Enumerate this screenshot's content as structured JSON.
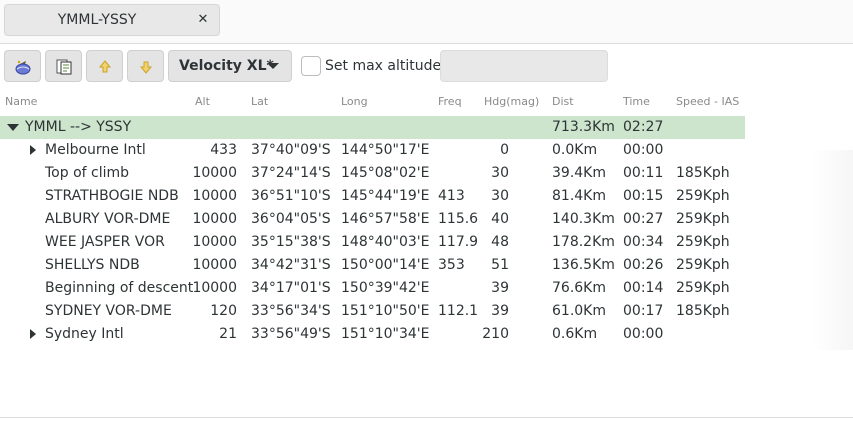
{
  "tab": {
    "title": "YMML-YSSY",
    "close": "✕"
  },
  "toolbar": {
    "dropdown_label": "Velocity XL*",
    "checkbox_label": "Set max altitude",
    "altitude_value": ""
  },
  "columns": [
    "Name",
    "Alt",
    "Lat",
    "Long",
    "Freq",
    "Hdg(mag)",
    "Dist",
    "Time",
    "Speed - IAS"
  ],
  "summary": {
    "name": "YMML --> YSSY",
    "dist": "713.3Km",
    "time": "02:27"
  },
  "rows": [
    {
      "name": "Melbourne Intl",
      "alt": "433",
      "lat": "37°40\"09'S",
      "long": "144°50\"17'E",
      "freq": "",
      "hdg": "0",
      "dist": "0.0Km",
      "time": "00:00",
      "speed": "",
      "expandable": true
    },
    {
      "name": "Top of climb",
      "alt": "10000",
      "lat": "37°24\"14'S",
      "long": "145°08\"02'E",
      "freq": "",
      "hdg": "30",
      "dist": "39.4Km",
      "time": "00:11",
      "speed": "185Kph",
      "expandable": false
    },
    {
      "name": "STRATHBOGIE NDB",
      "alt": "10000",
      "lat": "36°51\"10'S",
      "long": "145°44\"19'E",
      "freq": "413",
      "hdg": "30",
      "dist": "81.4Km",
      "time": "00:15",
      "speed": "259Kph",
      "expandable": false
    },
    {
      "name": "ALBURY VOR-DME",
      "alt": "10000",
      "lat": "36°04\"05'S",
      "long": "146°57\"58'E",
      "freq": "115.6",
      "hdg": "40",
      "dist": "140.3Km",
      "time": "00:27",
      "speed": "259Kph",
      "expandable": false
    },
    {
      "name": "WEE JASPER VOR",
      "alt": "10000",
      "lat": "35°15\"38'S",
      "long": "148°40\"03'E",
      "freq": "117.9",
      "hdg": "48",
      "dist": "178.2Km",
      "time": "00:34",
      "speed": "259Kph",
      "expandable": false
    },
    {
      "name": "SHELLYS NDB",
      "alt": "10000",
      "lat": "34°42\"31'S",
      "long": "150°00\"14'E",
      "freq": "353",
      "hdg": "51",
      "dist": "136.5Km",
      "time": "00:26",
      "speed": "259Kph",
      "expandable": false
    },
    {
      "name": "Beginning of descent",
      "alt": "10000",
      "lat": "34°17\"01'S",
      "long": "150°39\"42'E",
      "freq": "",
      "hdg": "39",
      "dist": "76.6Km",
      "time": "00:14",
      "speed": "259Kph",
      "expandable": false
    },
    {
      "name": "SYDNEY VOR-DME",
      "alt": "120",
      "lat": "33°56\"34'S",
      "long": "151°10\"50'E",
      "freq": "112.1",
      "hdg": "39",
      "dist": "61.0Km",
      "time": "00:17",
      "speed": "185Kph",
      "expandable": false
    },
    {
      "name": "Sydney Intl",
      "alt": "21",
      "lat": "33°56\"49'S",
      "long": "151°10\"34'E",
      "freq": "",
      "hdg": "210",
      "dist": "0.6Km",
      "time": "00:00",
      "speed": "",
      "expandable": true
    }
  ]
}
